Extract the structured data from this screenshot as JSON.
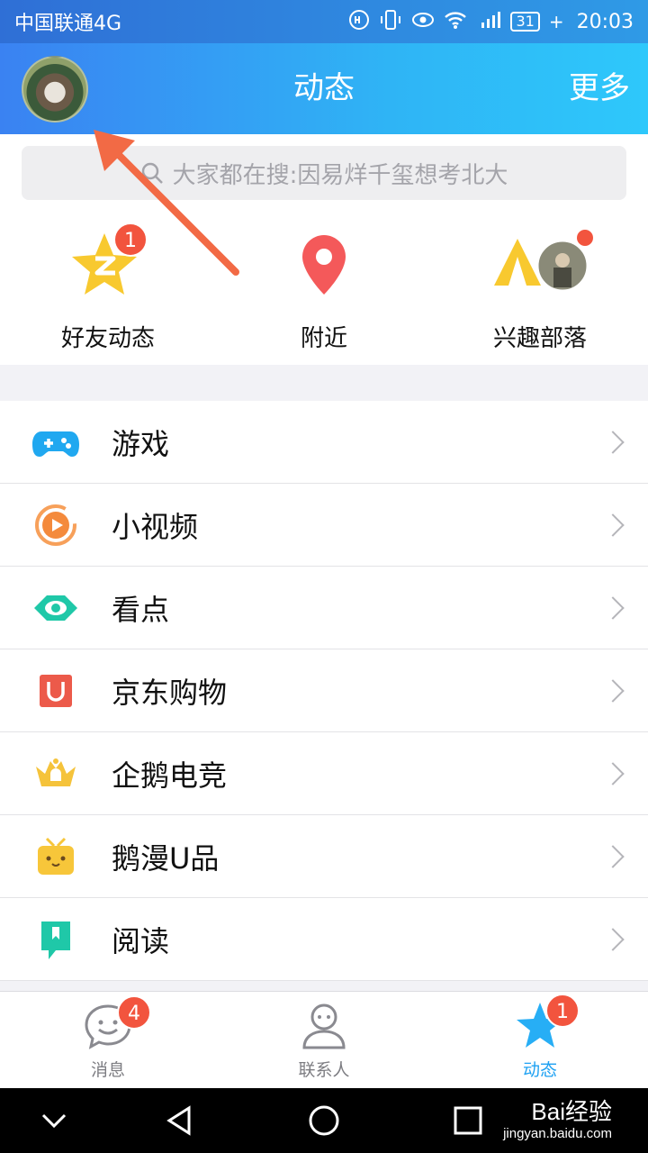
{
  "status_bar": {
    "carrier": "中国联通4G",
    "battery": "31",
    "time": "20:03",
    "network": "4G"
  },
  "header": {
    "title": "动态",
    "more": "更多"
  },
  "search": {
    "placeholder": "大家都在搜:因易烊千玺想考北大"
  },
  "shortcuts": [
    {
      "label": "好友动态",
      "icon": "qzone-star-icon",
      "badge": "1"
    },
    {
      "label": "附近",
      "icon": "location-pin-icon"
    },
    {
      "label": "兴趣部落",
      "icon": "tent-icon",
      "dot": true
    }
  ],
  "list": [
    {
      "label": "游戏",
      "icon": "gamepad-icon"
    },
    {
      "label": "小视频",
      "icon": "play-video-icon"
    },
    {
      "label": "看点",
      "icon": "eye-icon"
    },
    {
      "label": "京东购物",
      "icon": "shopping-bag-icon"
    },
    {
      "label": "企鹅电竞",
      "icon": "esports-crown-icon"
    },
    {
      "label": "鹅漫U品",
      "icon": "tv-mascot-icon"
    },
    {
      "label": "阅读",
      "icon": "bookmark-icon"
    }
  ],
  "tabs": [
    {
      "label": "消息",
      "icon": "chat-bubble-icon",
      "badge": "4"
    },
    {
      "label": "联系人",
      "icon": "person-icon"
    },
    {
      "label": "动态",
      "icon": "star-icon",
      "badge": "1",
      "active": true
    }
  ],
  "watermark": {
    "brand": "Bai经验",
    "url": "jingyan.baidu.com"
  },
  "colors": {
    "header_start": "#3a82f2",
    "header_end": "#2ec8fb",
    "badge": "#f2543e",
    "active_tab": "#1ea1f2",
    "arrow": "#f26a45"
  }
}
